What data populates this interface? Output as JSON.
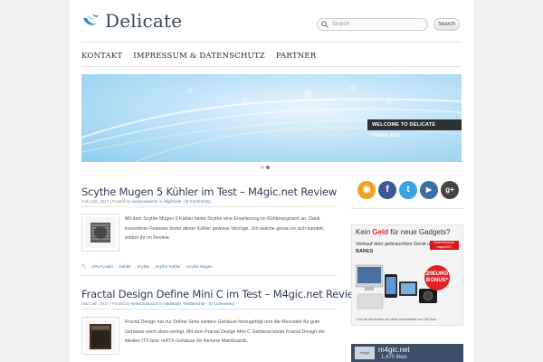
{
  "site": {
    "name": "Delicate"
  },
  "search": {
    "placeholder": "Search",
    "button_label": "Search"
  },
  "nav": {
    "items": [
      "KONTAKT",
      "IMPRESSUM & DATENSCHUTZ",
      "PARTNER"
    ]
  },
  "slider": {
    "caption": "WELCOME TO DELICATE TEMPLATE",
    "slide_count": 2,
    "active_slide": 2
  },
  "posts": [
    {
      "title": "Scythe Mugen 5 Kühler im Test – M4gic.net Review",
      "date": "Juni 11th, 2017",
      "posted_by": "Posted by",
      "author": "semiconductor",
      "in_label": "in",
      "category": "Allgemein",
      "comments": "(0 Comments)",
      "excerpt": "Mit dem Scythe Mugen 5 Kühler bietet Scythe eine Erweiterung im Kühlersegment an. Dank innovativer Features bietet dieser Kühler gewisse Vorzüge. Um welche genau es sich handelt, erfahrt ihr im Review.",
      "tags": [
        "CPU-Cooler",
        "Kühler",
        "Scythe",
        "Scythe Kühler",
        "Scythe Mugen"
      ]
    },
    {
      "title": "Fractal Design Define Mini C im Test – M4gic.net Review",
      "date": "März 8th, 2017",
      "posted_by": "Posted by",
      "author": "semiconductor",
      "in_label": "in",
      "category": "Hardware",
      "category_extra": "Testberichte",
      "comments": "(0 Comments)",
      "excerpt": "Fractal Design hat zur Define Serie weitere Gehäuse hinzugefügt und die Messlatte für gute Gehäuse noch oben verlegt. Mit dem Fractal Design Mini C Gehäuse bietet Fractal Design ein ideales ITX bzw. mATX-Gehäuse für kleinere Mainboards."
    }
  ],
  "social": [
    {
      "name": "rss-icon",
      "glyph": "◉",
      "color": "#f1a127"
    },
    {
      "name": "facebook-icon",
      "glyph": "f",
      "color": "#3b5998"
    },
    {
      "name": "twitter-icon",
      "glyph": "t",
      "color": "#3aa3e0"
    },
    {
      "name": "youtube-icon",
      "glyph": "▶",
      "color": "#3c6f9f"
    },
    {
      "name": "google-plus-icon",
      "glyph": "g+",
      "color": "#444444"
    }
  ],
  "ad": {
    "headline_pre": "Kein ",
    "headline_bold": "Geld",
    "headline_post": " für neue Gadgets?",
    "line1": "Verkauf dein gebrauchtes Gerät und kassiere",
    "line2": "BARES",
    "badge": "Gutscheincode: magic2017",
    "bonus": "20EURO BONUS*",
    "footnote": "* Nur für Neukunden ab einem Ankaufswert von 150 Euro."
  },
  "facebook_box": {
    "name": "m4gic.net",
    "likes": "1.470 likes",
    "thumb_label": "m4gic"
  },
  "colors": {
    "accent": "#3a79b8",
    "title": "#2f3d52",
    "caption_bg": "#2c3136"
  }
}
